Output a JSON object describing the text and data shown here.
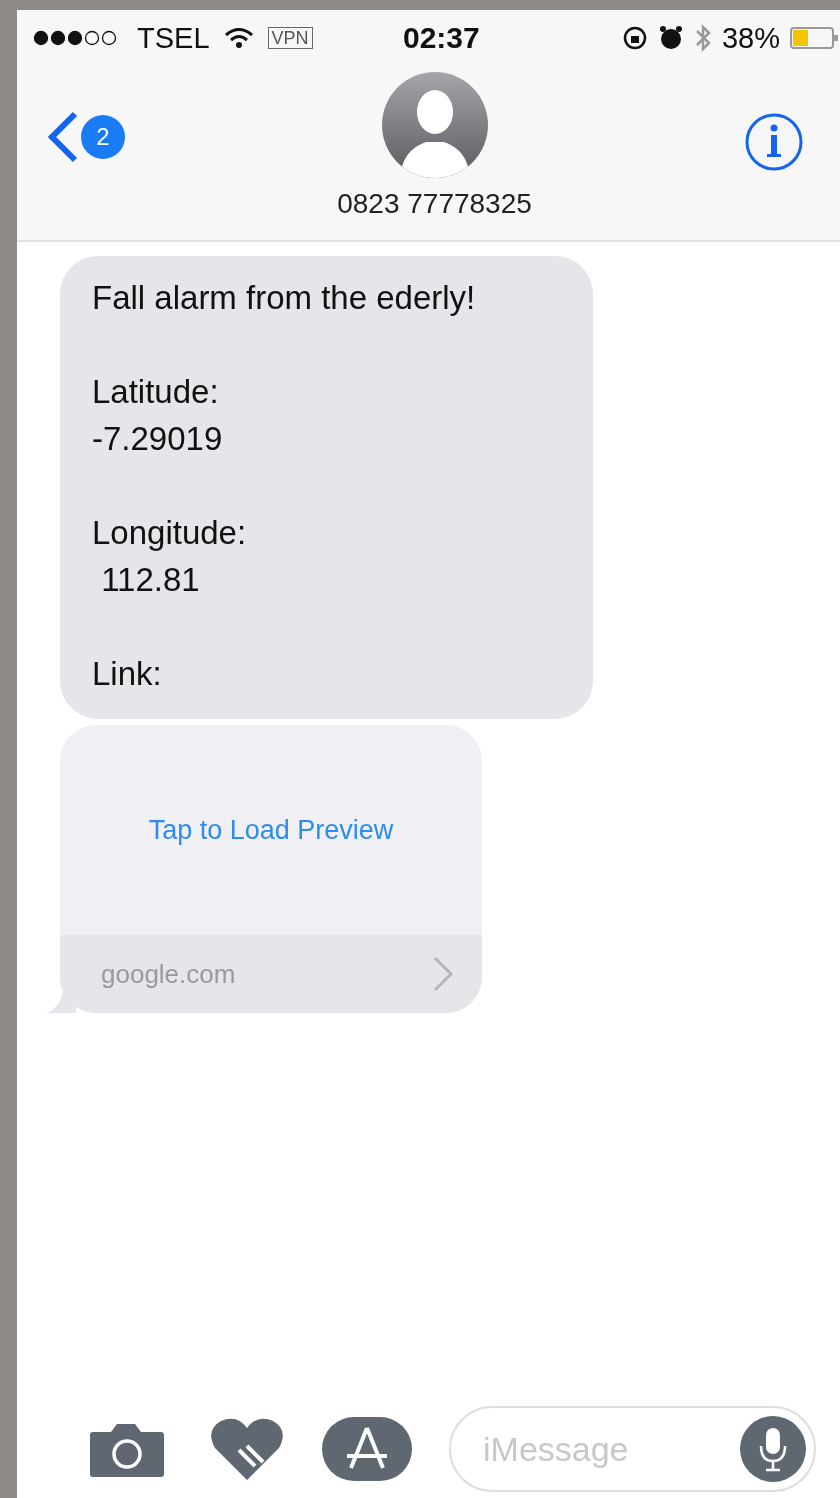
{
  "status_bar": {
    "carrier": "TSEL",
    "vpn": "VPN",
    "time": "02:37",
    "battery": "38%"
  },
  "nav": {
    "badge": "2",
    "contact": "0823 77778325"
  },
  "messages": [
    {
      "kind": "text",
      "text": "Fall alarm from the ederly!\n\nLatitude:\n-7.29019\n\nLongitude:\n 112.81\n\nLink:"
    },
    {
      "kind": "link",
      "action": "Tap to Load Preview",
      "domain": "google.com"
    }
  ],
  "composer": {
    "placeholder": "iMessage"
  }
}
